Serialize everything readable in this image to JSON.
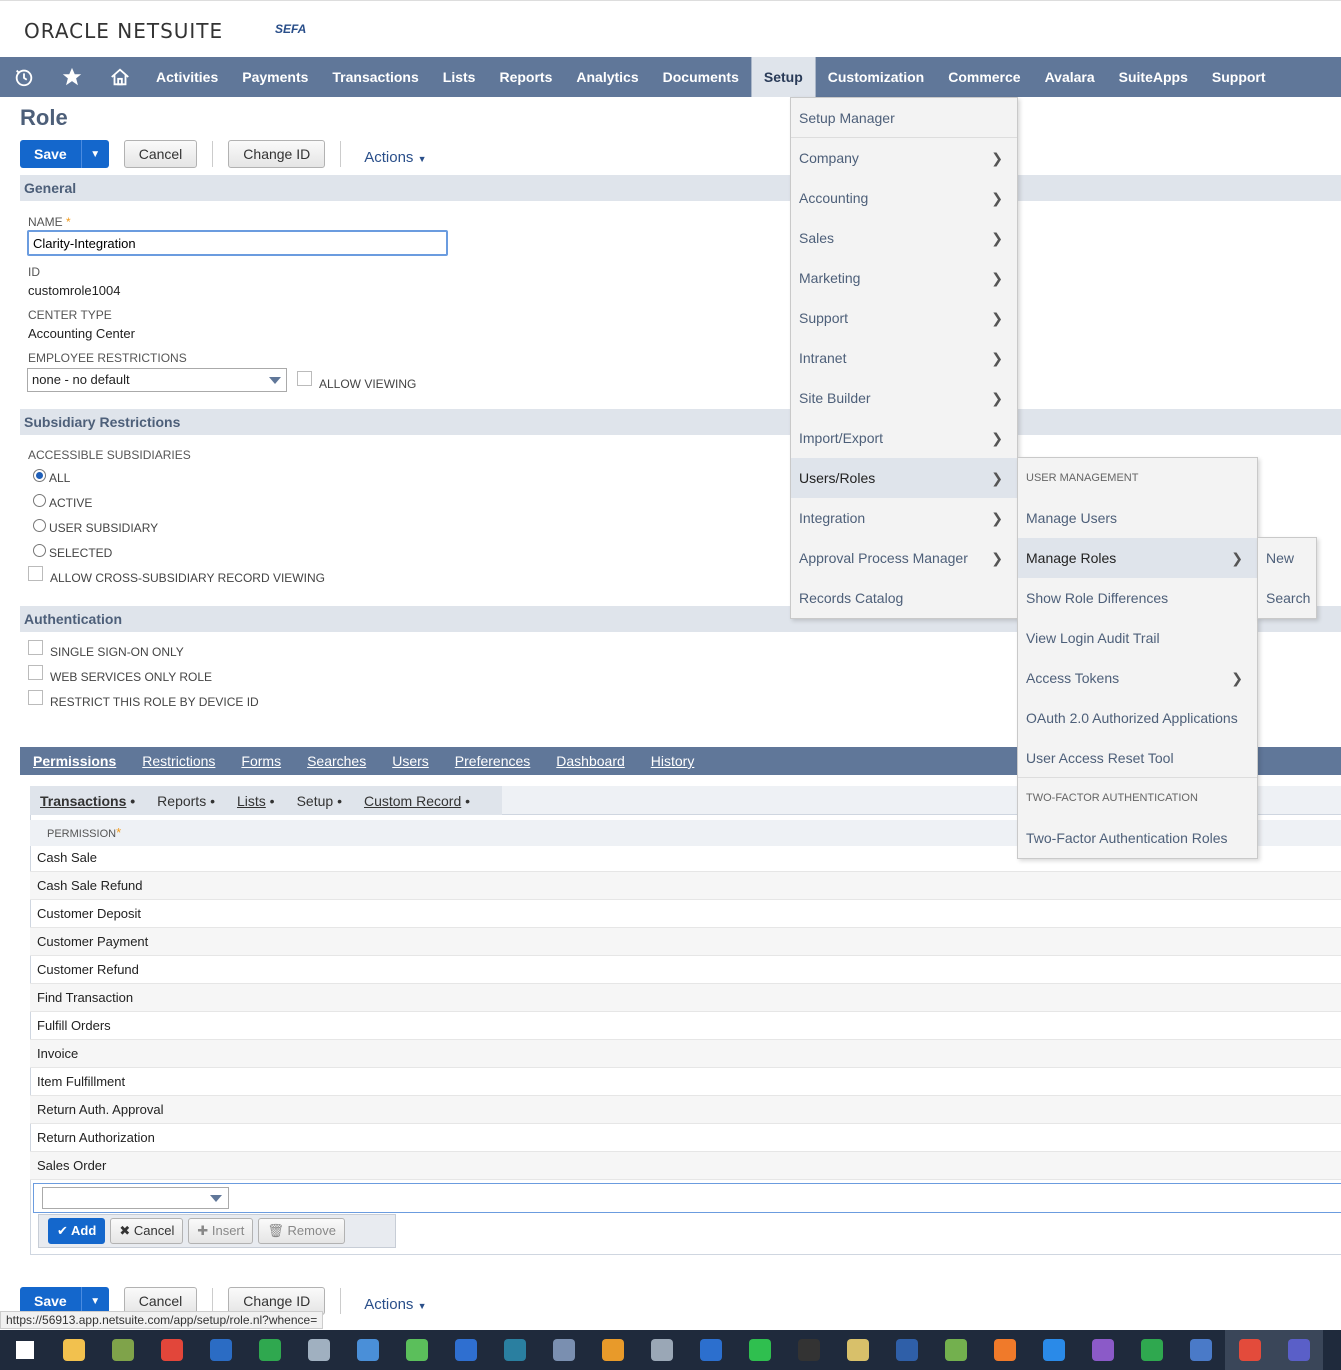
{
  "header": {
    "logo_text": "ORACLE NETSUITE",
    "logo_sub": "SEFA"
  },
  "nav": {
    "icons": [
      "recent-icon",
      "star-icon",
      "home-icon"
    ],
    "items": [
      "Activities",
      "Payments",
      "Transactions",
      "Lists",
      "Reports",
      "Analytics",
      "Documents",
      "Setup",
      "Customization",
      "Commerce",
      "Avalara",
      "SuiteApps",
      "Support"
    ],
    "active": "Setup"
  },
  "page": {
    "title": "Role",
    "save": "Save",
    "cancel": "Cancel",
    "change_id": "Change ID",
    "actions": "Actions"
  },
  "general": {
    "section": "General",
    "name_label": "NAME",
    "name_value": "Clarity-Integration",
    "id_label": "ID",
    "id_value": "customrole1004",
    "center_label": "CENTER TYPE",
    "center_value": "Accounting Center",
    "emp_label": "EMPLOYEE RESTRICTIONS",
    "emp_value": "none - no default",
    "allow_viewing": "ALLOW VIEWING"
  },
  "subsidiary": {
    "section": "Subsidiary Restrictions",
    "label": "ACCESSIBLE SUBSIDIARIES",
    "options": [
      "ALL",
      "ACTIVE",
      "USER SUBSIDIARY",
      "SELECTED"
    ],
    "selected": "ALL",
    "cross": "ALLOW CROSS-SUBSIDIARY RECORD VIEWING"
  },
  "auth": {
    "section": "Authentication",
    "options": [
      "SINGLE SIGN-ON ONLY",
      "WEB SERVICES ONLY ROLE",
      "RESTRICT THIS ROLE BY DEVICE ID"
    ]
  },
  "tabs": [
    "Permissions",
    "Restrictions",
    "Forms",
    "Searches",
    "Users",
    "Preferences",
    "Dashboard",
    "History"
  ],
  "subtabs": [
    "Transactions",
    "Reports",
    "Lists",
    "Setup",
    "Custom Record"
  ],
  "permissions": {
    "header": "PERMISSION",
    "rows": [
      "Cash Sale",
      "Cash Sale Refund",
      "Customer Deposit",
      "Customer Payment",
      "Customer Refund",
      "Find Transaction",
      "Fulfill Orders",
      "Invoice",
      "Item Fulfillment",
      "Return Auth. Approval",
      "Return Authorization",
      "Sales Order"
    ]
  },
  "line_buttons": {
    "add": "Add",
    "cancel": "Cancel",
    "insert": "Insert",
    "remove": "Remove"
  },
  "setup_menu": [
    {
      "label": "Setup Manager",
      "sub": false
    },
    {
      "label": "Company",
      "sub": true
    },
    {
      "label": "Accounting",
      "sub": true
    },
    {
      "label": "Sales",
      "sub": true
    },
    {
      "label": "Marketing",
      "sub": true
    },
    {
      "label": "Support",
      "sub": true
    },
    {
      "label": "Intranet",
      "sub": true
    },
    {
      "label": "Site Builder",
      "sub": true
    },
    {
      "label": "Import/Export",
      "sub": true
    },
    {
      "label": "Users/Roles",
      "sub": true
    },
    {
      "label": "Integration",
      "sub": true
    },
    {
      "label": "Approval Process Manager",
      "sub": true
    },
    {
      "label": "Records Catalog",
      "sub": false
    }
  ],
  "users_menu": [
    {
      "label": "USER MANAGEMENT",
      "hdr": true
    },
    {
      "label": "Manage Users"
    },
    {
      "label": "Manage Roles",
      "sub": true
    },
    {
      "label": "Show Role Differences"
    },
    {
      "label": "View Login Audit Trail"
    },
    {
      "label": "Access Tokens",
      "sub": true
    },
    {
      "label": "OAuth 2.0 Authorized Applications"
    },
    {
      "label": "User Access Reset Tool"
    },
    {
      "label": "TWO-FACTOR AUTHENTICATION",
      "hdr": true
    },
    {
      "label": "Two-Factor Authentication Roles"
    }
  ],
  "roles_menu": [
    "New",
    "Search"
  ],
  "status_url": "https://56913.app.netsuite.com/app/setup/role.nl?whence=",
  "taskbar": {
    "icons": [
      "windows-start-icon",
      "file-explorer-icon",
      "tree-app-icon",
      "app-icon",
      "blue-shark-icon",
      "green-diamond-icon",
      "network-icon",
      "globe-icon",
      "globe-green-icon",
      "shield-icon",
      "s-app-icon",
      "image-app-icon",
      "arrow-app-icon",
      "calculator-icon",
      "presentation-icon",
      "whatsapp-icon",
      "terminal-icon",
      "network-share-icon",
      "powershell-icon",
      "notepad-icon",
      "orange-app-icon",
      "vscode-icon",
      "visual-studio-icon",
      "excel-icon",
      "remote-desktop-icon",
      "chrome-icon",
      "teams-icon"
    ],
    "colors": [
      "#ffffff",
      "#f2c14e",
      "#7fa34a",
      "#e2463a",
      "#2b6cc4",
      "#2fa84f",
      "#a0b0c0",
      "#4a8fd8",
      "#5bbf5b",
      "#2f6fd0",
      "#2a7fa0",
      "#7a8fb0",
      "#e89a2a",
      "#9aa7b6",
      "#2c6fce",
      "#2fbf4f",
      "#333333",
      "#d8c06a",
      "#2f5fa8",
      "#73b04e",
      "#f07a2a",
      "#2a8ae8",
      "#8b5ac8",
      "#2fa84f",
      "#4a7ac8",
      "#e34b3b",
      "#5a5fc8"
    ],
    "active": [
      25,
      26
    ]
  }
}
